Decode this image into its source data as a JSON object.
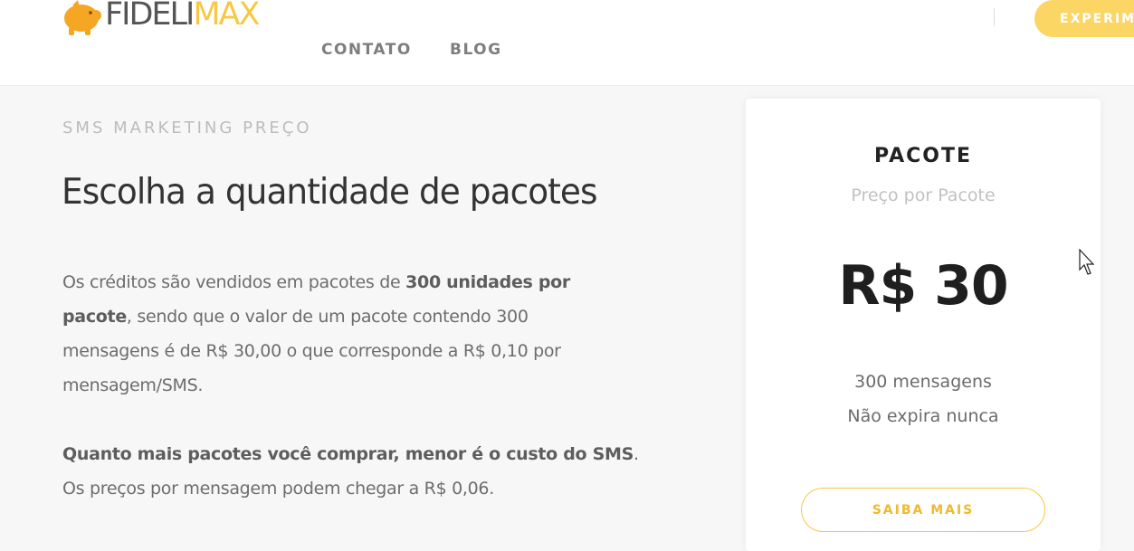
{
  "header": {
    "logo": {
      "part1": "FIDELI",
      "part2": "MAX",
      "icon": "piggy-bank-icon"
    },
    "nav": [
      {
        "label": "CONTATO"
      },
      {
        "label": "BLOG"
      }
    ],
    "cta_label": "EXPERIMENTE"
  },
  "main": {
    "eyebrow": "SMS MARKETING PREÇO",
    "heading": "Escolha a quantidade de pacotes",
    "p1": {
      "t1": "Os créditos são vendidos em pacotes de ",
      "b1": "300 unidades por pacote",
      "t2": ", sendo que o valor de um pacote contendo 300 mensagens é de R$ 30,00 o que corresponde a R$ 0,10 por mensagem/SMS."
    },
    "p2": {
      "b1": "Quanto mais pacotes você comprar, menor é o custo do SMS",
      "t1": ".",
      "t2": "Os preços por mensagem podem chegar a R$ 0,06."
    }
  },
  "card": {
    "title": "PACOTE",
    "subtitle": "Preço por Pacote",
    "price": "R$ 30",
    "features": [
      "300 mensagens",
      "Não expira nunca"
    ],
    "button_label": "SAIBA MAIS"
  },
  "colors": {
    "accent": "#fcd665",
    "text": "#6d6d6d",
    "background": "#f7f7f7"
  }
}
